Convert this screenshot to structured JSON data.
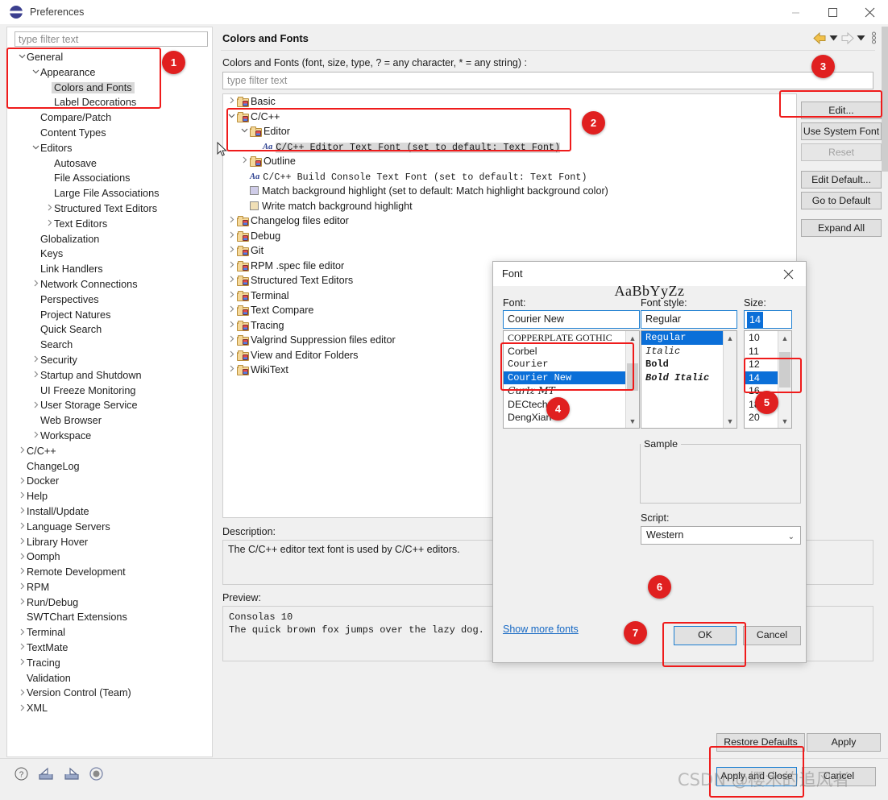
{
  "window": {
    "title": "Preferences",
    "minimize": "−",
    "maximize": "□",
    "close": "✕"
  },
  "sidebar": {
    "filter_placeholder": "type filter text",
    "items": [
      {
        "label": "General",
        "indent": 0,
        "twisty": "v"
      },
      {
        "label": "Appearance",
        "indent": 1,
        "twisty": "v"
      },
      {
        "label": "Colors and Fonts",
        "indent": 2,
        "twisty": "",
        "selected": true
      },
      {
        "label": "Label Decorations",
        "indent": 2,
        "twisty": ""
      },
      {
        "label": "Compare/Patch",
        "indent": 1,
        "twisty": ""
      },
      {
        "label": "Content Types",
        "indent": 1,
        "twisty": ""
      },
      {
        "label": "Editors",
        "indent": 1,
        "twisty": "v"
      },
      {
        "label": "Autosave",
        "indent": 2,
        "twisty": ""
      },
      {
        "label": "File Associations",
        "indent": 2,
        "twisty": ""
      },
      {
        "label": "Large File Associations",
        "indent": 2,
        "twisty": ""
      },
      {
        "label": "Structured Text Editors",
        "indent": 2,
        "twisty": ">"
      },
      {
        "label": "Text Editors",
        "indent": 2,
        "twisty": ">"
      },
      {
        "label": "Globalization",
        "indent": 1,
        "twisty": ""
      },
      {
        "label": "Keys",
        "indent": 1,
        "twisty": ""
      },
      {
        "label": "Link Handlers",
        "indent": 1,
        "twisty": ""
      },
      {
        "label": "Network Connections",
        "indent": 1,
        "twisty": ">"
      },
      {
        "label": "Perspectives",
        "indent": 1,
        "twisty": ""
      },
      {
        "label": "Project Natures",
        "indent": 1,
        "twisty": ""
      },
      {
        "label": "Quick Search",
        "indent": 1,
        "twisty": ""
      },
      {
        "label": "Search",
        "indent": 1,
        "twisty": ""
      },
      {
        "label": "Security",
        "indent": 1,
        "twisty": ">"
      },
      {
        "label": "Startup and Shutdown",
        "indent": 1,
        "twisty": ">"
      },
      {
        "label": "UI Freeze Monitoring",
        "indent": 1,
        "twisty": ""
      },
      {
        "label": "User Storage Service",
        "indent": 1,
        "twisty": ">"
      },
      {
        "label": "Web Browser",
        "indent": 1,
        "twisty": ""
      },
      {
        "label": "Workspace",
        "indent": 1,
        "twisty": ">"
      },
      {
        "label": "C/C++",
        "indent": 0,
        "twisty": ">"
      },
      {
        "label": "ChangeLog",
        "indent": 0,
        "twisty": ""
      },
      {
        "label": "Docker",
        "indent": 0,
        "twisty": ">"
      },
      {
        "label": "Help",
        "indent": 0,
        "twisty": ">"
      },
      {
        "label": "Install/Update",
        "indent": 0,
        "twisty": ">"
      },
      {
        "label": "Language Servers",
        "indent": 0,
        "twisty": ">"
      },
      {
        "label": "Library Hover",
        "indent": 0,
        "twisty": ">"
      },
      {
        "label": "Oomph",
        "indent": 0,
        "twisty": ">"
      },
      {
        "label": "Remote Development",
        "indent": 0,
        "twisty": ">"
      },
      {
        "label": "RPM",
        "indent": 0,
        "twisty": ">"
      },
      {
        "label": "Run/Debug",
        "indent": 0,
        "twisty": ">"
      },
      {
        "label": "SWTChart Extensions",
        "indent": 0,
        "twisty": ""
      },
      {
        "label": "Terminal",
        "indent": 0,
        "twisty": ">"
      },
      {
        "label": "TextMate",
        "indent": 0,
        "twisty": ">"
      },
      {
        "label": "Tracing",
        "indent": 0,
        "twisty": ">"
      },
      {
        "label": "Validation",
        "indent": 0,
        "twisty": ""
      },
      {
        "label": "Version Control (Team)",
        "indent": 0,
        "twisty": ">"
      },
      {
        "label": "XML",
        "indent": 0,
        "twisty": ">"
      }
    ]
  },
  "page": {
    "title": "Colors and Fonts",
    "filter_caption": "Colors and Fonts (font, size, type, ? = any character, * = any string) :",
    "filter_placeholder": "type filter text",
    "tree": [
      {
        "label": "Basic",
        "indent": 0,
        "twisty": ">",
        "icon": "folder-icon"
      },
      {
        "label": "C/C++",
        "indent": 0,
        "twisty": "v",
        "icon": "folder-icon"
      },
      {
        "label": "Editor",
        "indent": 1,
        "twisty": "v",
        "icon": "folder-icon"
      },
      {
        "label": "C/C++ Editor Text Font (set to default: Text Font)",
        "indent": 2,
        "twisty": "",
        "icon": "font-aa-icon",
        "mono": true,
        "selected": true
      },
      {
        "label": "Outline",
        "indent": 1,
        "twisty": ">",
        "icon": "folder-icon"
      },
      {
        "label": "C/C++ Build Console Text Font (set to default: Text Font)",
        "indent": 1,
        "twisty": "",
        "icon": "font-aa-icon",
        "mono": true
      },
      {
        "label": "Match background highlight (set to default: Match highlight background color)",
        "indent": 1,
        "twisty": "",
        "icon": "color-swatch-icon",
        "swatch": "#cfcce8"
      },
      {
        "label": "Write match background highlight",
        "indent": 1,
        "twisty": "",
        "icon": "color-swatch-icon",
        "swatch": "#f0dfb6"
      },
      {
        "label": "Changelog files editor",
        "indent": 0,
        "twisty": ">",
        "icon": "folder-icon"
      },
      {
        "label": "Debug",
        "indent": 0,
        "twisty": ">",
        "icon": "folder-icon"
      },
      {
        "label": "Git",
        "indent": 0,
        "twisty": ">",
        "icon": "folder-icon"
      },
      {
        "label": "RPM .spec file editor",
        "indent": 0,
        "twisty": ">",
        "icon": "folder-icon"
      },
      {
        "label": "Structured Text Editors",
        "indent": 0,
        "twisty": ">",
        "icon": "folder-icon"
      },
      {
        "label": "Terminal",
        "indent": 0,
        "twisty": ">",
        "icon": "folder-icon"
      },
      {
        "label": "Text Compare",
        "indent": 0,
        "twisty": ">",
        "icon": "folder-icon"
      },
      {
        "label": "Tracing",
        "indent": 0,
        "twisty": ">",
        "icon": "folder-icon"
      },
      {
        "label": "Valgrind Suppression files editor",
        "indent": 0,
        "twisty": ">",
        "icon": "folder-icon"
      },
      {
        "label": "View and Editor Folders",
        "indent": 0,
        "twisty": ">",
        "icon": "folder-icon"
      },
      {
        "label": "WikiText",
        "indent": 0,
        "twisty": ">",
        "icon": "folder-icon"
      }
    ],
    "buttons": [
      {
        "label": "Edit...",
        "disabled": false
      },
      {
        "label": "Use System Font",
        "disabled": false
      },
      {
        "label": "Reset",
        "disabled": true
      },
      {
        "label": "Edit Default...",
        "disabled": false,
        "gap": true
      },
      {
        "label": "Go to Default",
        "disabled": false
      },
      {
        "label": "Expand All",
        "disabled": false,
        "gap": true
      }
    ],
    "description_label": "Description:",
    "description_text": "The C/C++ editor text font is used by C/C++ editors.",
    "preview_label": "Preview:",
    "preview_line1": "Consolas 10",
    "preview_line2": "The quick brown fox jumps over the lazy dog."
  },
  "footer": {
    "restore_defaults": "Restore Defaults",
    "apply": "Apply",
    "apply_and_close": "Apply and Close",
    "cancel": "Cancel",
    "icons": [
      "help-icon",
      "import-icon",
      "export-icon",
      "record-icon"
    ]
  },
  "font_dialog": {
    "title": "Font",
    "close": "✕",
    "font_label": "Font:",
    "font_value": "Courier New",
    "font_options": [
      {
        "label": "COPPERPLATE GOTHIC",
        "selected": false
      },
      {
        "label": "Corbel",
        "selected": false
      },
      {
        "label": "Courier",
        "selected": false
      },
      {
        "label": "Courier New",
        "selected": true
      },
      {
        "label": "Curlz MT",
        "selected": false
      },
      {
        "label": "DECtech",
        "selected": false
      },
      {
        "label": "DengXian",
        "selected": false
      }
    ],
    "style_label": "Font style:",
    "style_value": "Regular",
    "style_options": [
      {
        "label": "Regular",
        "selected": true
      },
      {
        "label": "Italic",
        "selected": false
      },
      {
        "label": "Bold",
        "selected": false
      },
      {
        "label": "Bold Italic",
        "selected": false
      }
    ],
    "size_label": "Size:",
    "size_value": "14",
    "size_options": [
      {
        "label": "10",
        "selected": false
      },
      {
        "label": "11",
        "selected": false
      },
      {
        "label": "12",
        "selected": false
      },
      {
        "label": "14",
        "selected": true
      },
      {
        "label": "16",
        "selected": false
      },
      {
        "label": "18",
        "selected": false
      },
      {
        "label": "20",
        "selected": false
      }
    ],
    "sample_label": "Sample",
    "sample_text": "AaBbYyZz",
    "script_label": "Script:",
    "script_value": "Western",
    "show_more": "Show more fonts",
    "ok": "OK",
    "cancel": "Cancel"
  },
  "annotations": {
    "badges": [
      "1",
      "2",
      "3",
      "4",
      "5",
      "6",
      "7"
    ],
    "accent_color": "#e02020"
  },
  "watermark": "CSDN @樱木的追风者"
}
